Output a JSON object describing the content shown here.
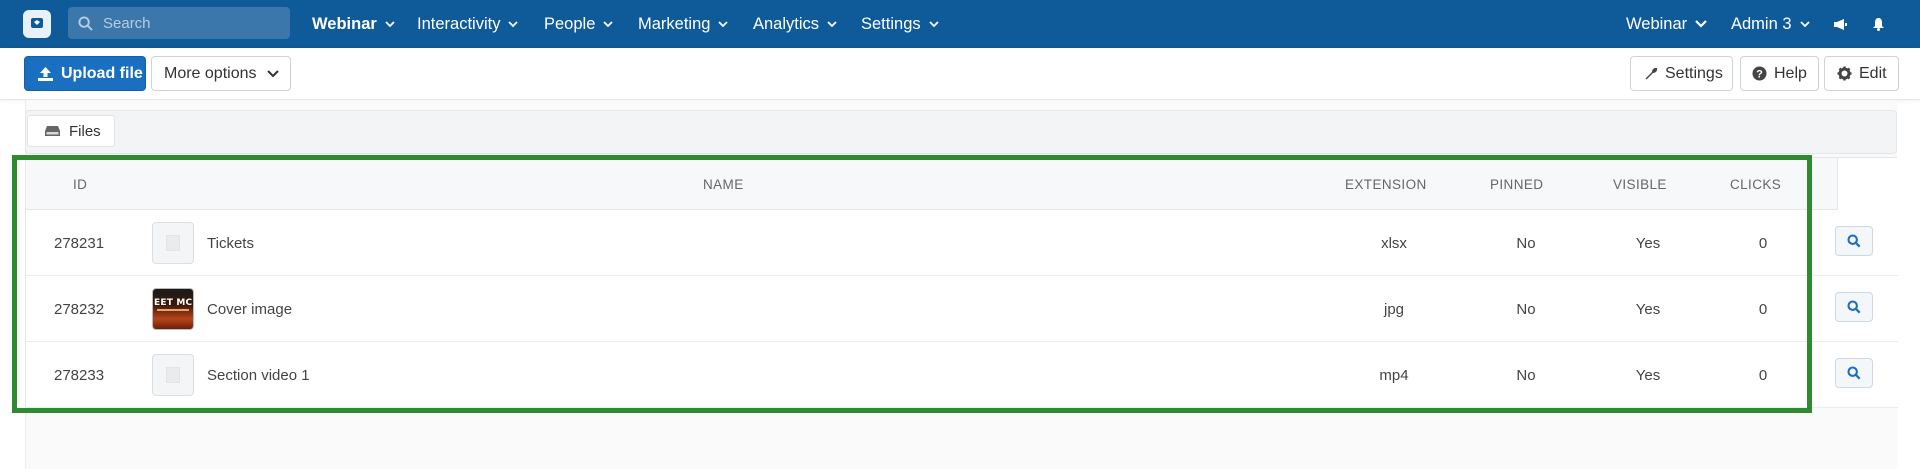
{
  "nav": {
    "search_placeholder": "Search",
    "items": [
      {
        "label": "Webinar",
        "active": true
      },
      {
        "label": "Interactivity"
      },
      {
        "label": "People"
      },
      {
        "label": "Marketing"
      },
      {
        "label": "Analytics"
      },
      {
        "label": "Settings"
      }
    ],
    "right": {
      "context": "Webinar",
      "user": "Admin 3"
    }
  },
  "toolbar": {
    "upload_label": "Upload file",
    "more_options_label": "More options",
    "settings_label": "Settings",
    "help_label": "Help",
    "edit_label": "Edit"
  },
  "tabs": [
    {
      "label": "Files"
    }
  ],
  "table": {
    "columns": [
      "ID",
      "NAME",
      "EXTENSION",
      "PINNED",
      "VISIBLE",
      "CLICKS"
    ],
    "rows": [
      {
        "id": "278231",
        "name": "Tickets",
        "extension": "xlsx",
        "pinned": "No",
        "visible": "Yes",
        "clicks": "0",
        "thumb": "file"
      },
      {
        "id": "278232",
        "name": "Cover image",
        "extension": "jpg",
        "pinned": "No",
        "visible": "Yes",
        "clicks": "0",
        "thumb": "image"
      },
      {
        "id": "278233",
        "name": "Section video 1",
        "extension": "mp4",
        "pinned": "No",
        "visible": "Yes",
        "clicks": "0",
        "thumb": "file"
      }
    ]
  },
  "colors": {
    "nav_bg": "#0f5a99",
    "primary": "#1a6fc0",
    "highlight": "#2e8b2e"
  }
}
